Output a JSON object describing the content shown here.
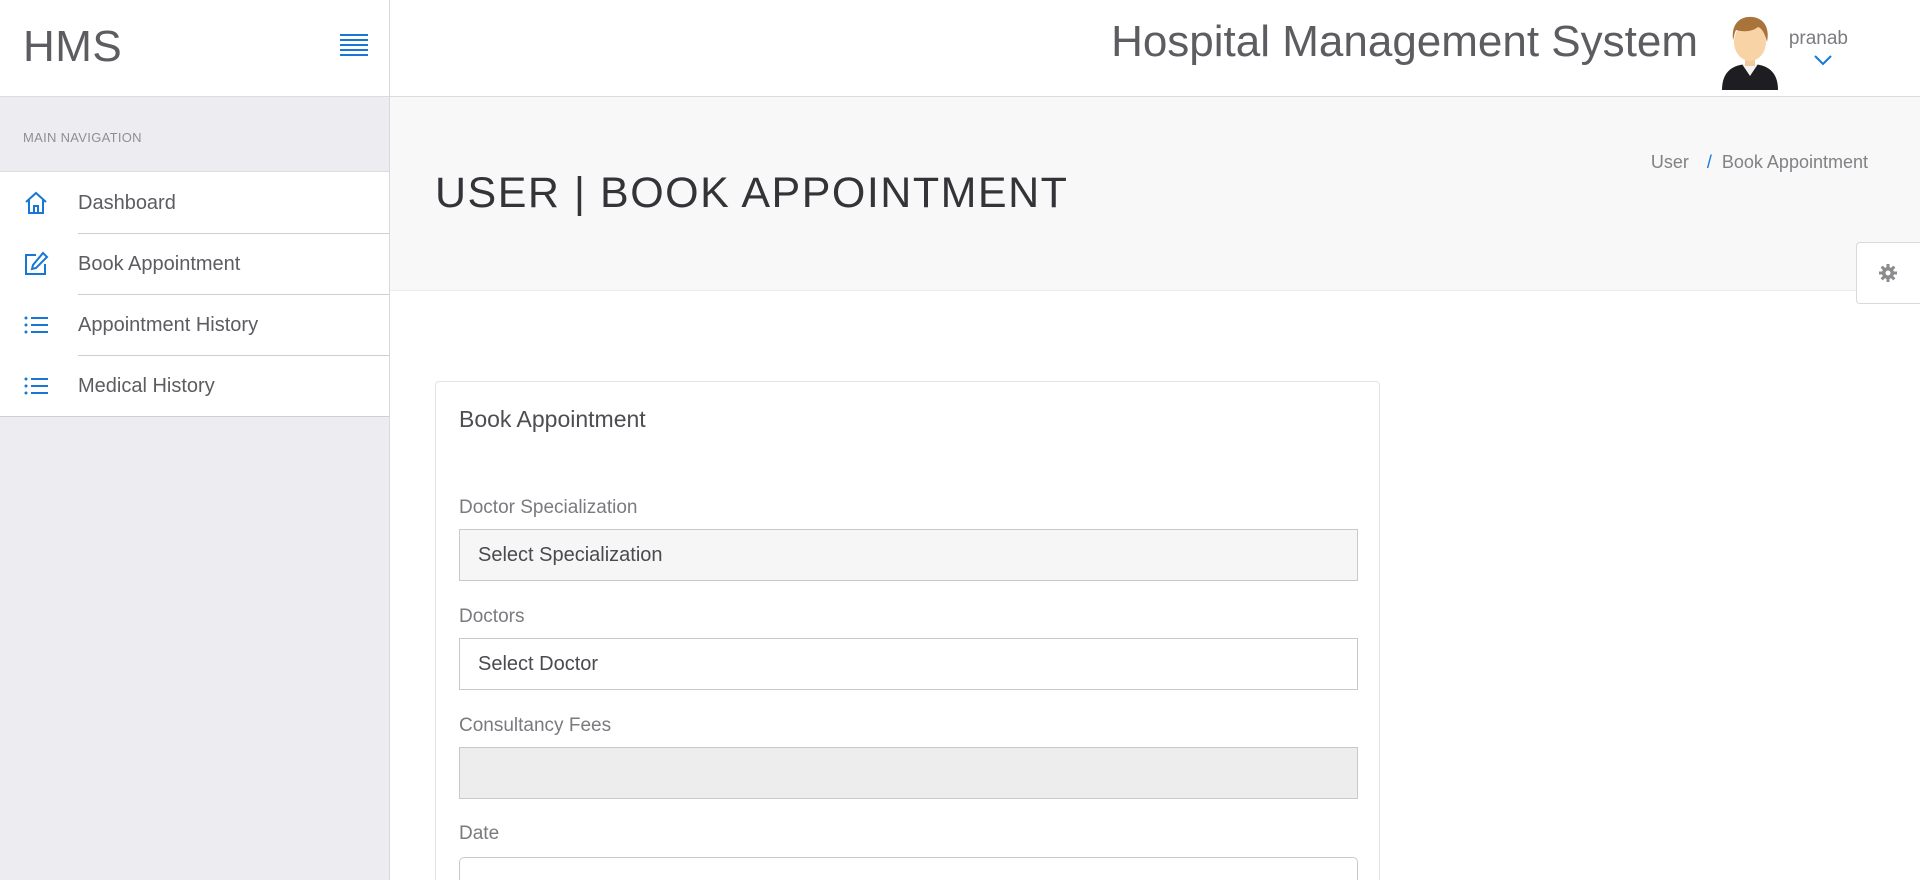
{
  "sidebar": {
    "brand": "HMS",
    "nav_label": "MAIN NAVIGATION",
    "items": [
      {
        "label": "Dashboard",
        "icon": "home-icon"
      },
      {
        "label": "Book Appointment",
        "icon": "edit-icon"
      },
      {
        "label": "Appointment History",
        "icon": "list-icon"
      },
      {
        "label": "Medical History",
        "icon": "list-icon"
      }
    ]
  },
  "header": {
    "app_title": "Hospital Management System",
    "user_name": "pranab"
  },
  "page": {
    "title": "USER | BOOK APPOINTMENT",
    "breadcrumb": [
      "User",
      "Book Appointment"
    ]
  },
  "form": {
    "title": "Book Appointment",
    "specialization_label": "Doctor Specialization",
    "specialization_value": "Select Specialization",
    "doctor_label": "Doctors",
    "doctor_value": "Select Doctor",
    "fees_label": "Consultancy Fees",
    "fees_value": "",
    "date_label": "Date",
    "date_value": ""
  },
  "colors": {
    "accent": "#1877d4",
    "sidebar_bg": "#ededf1",
    "page_header_bg": "#f8f8f8"
  }
}
